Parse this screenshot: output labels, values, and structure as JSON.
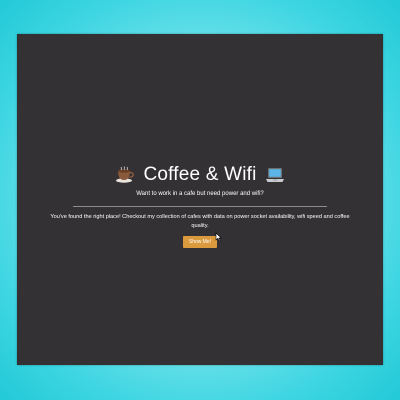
{
  "hero": {
    "title": "Coffee & Wifi",
    "left_icon": "coffee-cup-icon",
    "right_icon": "laptop-icon",
    "subtitle": "Want to work in a cafe but need power and wifi?",
    "description": "You've found the right place! Checkout my collection of cafes with data on power socket availability, wifi speed and coffee quality.",
    "button_label": "Show Me!"
  },
  "colors": {
    "background_gradient": "#3fd6e2",
    "window_bg": "#343134",
    "button_bg": "#dc9a3e",
    "text": "#ffffff"
  }
}
